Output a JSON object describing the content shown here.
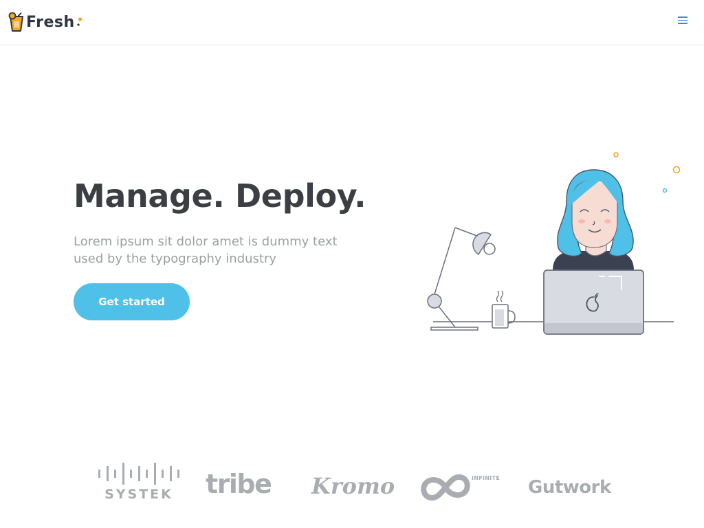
{
  "nav": {
    "logo_text": "Fresh",
    "menu_icon": "hamburger-icon"
  },
  "hero": {
    "title": "Manage. Deploy.",
    "subtitle": "Lorem ipsum sit dolor amet is dummy text used by the typography industry",
    "cta_label": "Get started"
  },
  "illustration": {
    "subject": "woman-working-at-laptop",
    "icons": [
      "desk-lamp-icon",
      "coffee-mug-icon",
      "laptop-icon"
    ]
  },
  "partners": {
    "logos": [
      "SYSTEK",
      "tribe",
      "Kromo",
      "INFINITE",
      "Gutwork"
    ]
  },
  "colors": {
    "primary": "#4fc0e8",
    "heading": "#3b3f44",
    "text_muted": "#9aa0a6",
    "accent": "#f5a623",
    "logo_gray": "#a9adb2",
    "menu": "#3f8ad8"
  }
}
